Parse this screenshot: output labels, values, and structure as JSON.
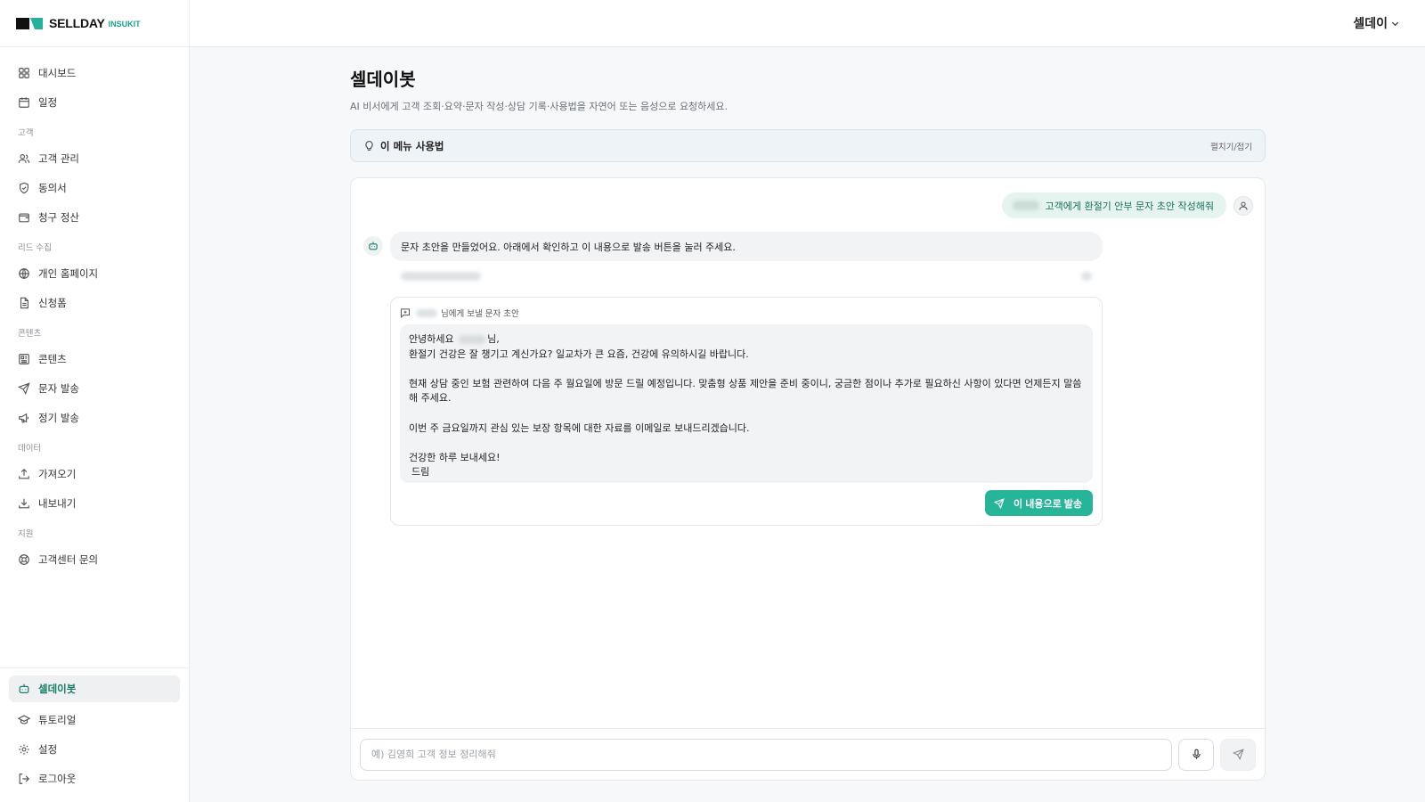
{
  "brand": {
    "name": "SELLDAY",
    "sub": "INSUKIT"
  },
  "user": {
    "name": "셀데이"
  },
  "sidebar": {
    "top": [
      {
        "label": "대시보드",
        "icon": "dashboard-icon"
      },
      {
        "label": "일정",
        "icon": "calendar-icon"
      }
    ],
    "sections": [
      {
        "title": "고객",
        "items": [
          {
            "label": "고객 관리",
            "icon": "users-icon"
          },
          {
            "label": "동의서",
            "icon": "shield-icon"
          },
          {
            "label": "청구 정산",
            "icon": "wallet-icon"
          }
        ]
      },
      {
        "title": "리드 수집",
        "items": [
          {
            "label": "개인 홈페이지",
            "icon": "globe-icon"
          },
          {
            "label": "신청폼",
            "icon": "file-icon"
          }
        ]
      },
      {
        "title": "콘텐츠",
        "items": [
          {
            "label": "콘텐츠",
            "icon": "newspaper-icon"
          },
          {
            "label": "문자 발송",
            "icon": "send-icon"
          },
          {
            "label": "정기 발송",
            "icon": "megaphone-icon"
          }
        ]
      },
      {
        "title": "데이터",
        "items": [
          {
            "label": "가져오기",
            "icon": "upload-icon"
          },
          {
            "label": "내보내기",
            "icon": "download-icon"
          }
        ]
      },
      {
        "title": "지원",
        "items": [
          {
            "label": "고객센터 문의",
            "icon": "lifebuoy-icon"
          }
        ]
      }
    ],
    "bottom": [
      {
        "label": "셀데이봇",
        "icon": "bot-icon",
        "active": true
      },
      {
        "label": "튜토리얼",
        "icon": "graduation-cap-icon"
      },
      {
        "label": "설정",
        "icon": "gear-icon"
      },
      {
        "label": "로그아웃",
        "icon": "logout-icon"
      }
    ]
  },
  "page": {
    "title": "셀데이봇",
    "subtitle": "AI 비서에게 고객 조회·요약·문자 작성·상담 기록·사용법을 자연어 또는 음성으로 요청하세요.",
    "howto_title": "이 메뉴 사용법",
    "howto_toggle": "펼치기/접기"
  },
  "chat": {
    "user_message": "고객에게 환절기 안부 문자 초안 작성해줘",
    "bot_message": "문자 초안을 만들었어요. 아래에서 확인하고 이 내용으로 발송 버튼을 눌러 주세요.",
    "draft_header": "님에게 보낼 문자 초안",
    "draft": {
      "line1_pre": "안녕하세요",
      "line1_post": "님,",
      "line2": "환절기 건강은 잘 챙기고 계신가요? 일교차가 큰 요즘, 건강에 유의하시길 바랍니다.",
      "line3": "현재 상담 중인 보험 관련하여 다음 주 월요일에 방문 드릴 예정입니다. 맞춤형 상품 제안을 준비 중이니, 궁금한 점이나 추가로 필요하신 사항이 있다면 언제든지 말씀해 주세요.",
      "line4": "이번 주 금요일까지 관심 있는 보장 항목에 대한 자료를 이메일로 보내드리겠습니다.",
      "line5": "건강한 하루 보내세요!",
      "line6": "드림"
    },
    "send_button": "이 내용으로 발송"
  },
  "composer": {
    "placeholder": "예) 김영희 고객 정보 정리해줘"
  },
  "colors": {
    "accent": "#27b59a",
    "brand_green": "#1aa08c",
    "user_bubble": "#e6f4f0"
  }
}
